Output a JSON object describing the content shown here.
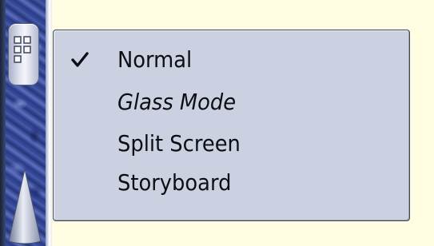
{
  "menu": {
    "items": [
      {
        "label": "Normal",
        "checked": true,
        "icon": "checkmark-icon"
      },
      {
        "label": "Glass Mode",
        "checked": false
      },
      {
        "label": "Split Screen",
        "checked": false
      },
      {
        "label": "Storyboard",
        "checked": false
      }
    ]
  },
  "toolbar": {
    "layout_button_icon": "grid-layout-icon",
    "scroll_icon": "scroll-up-arrow-icon"
  },
  "colors": {
    "background": "#fffde2",
    "menu_background": "#cbd1e0",
    "menu_border": "#3e4658",
    "strip_blue": "#3b4fa0"
  }
}
